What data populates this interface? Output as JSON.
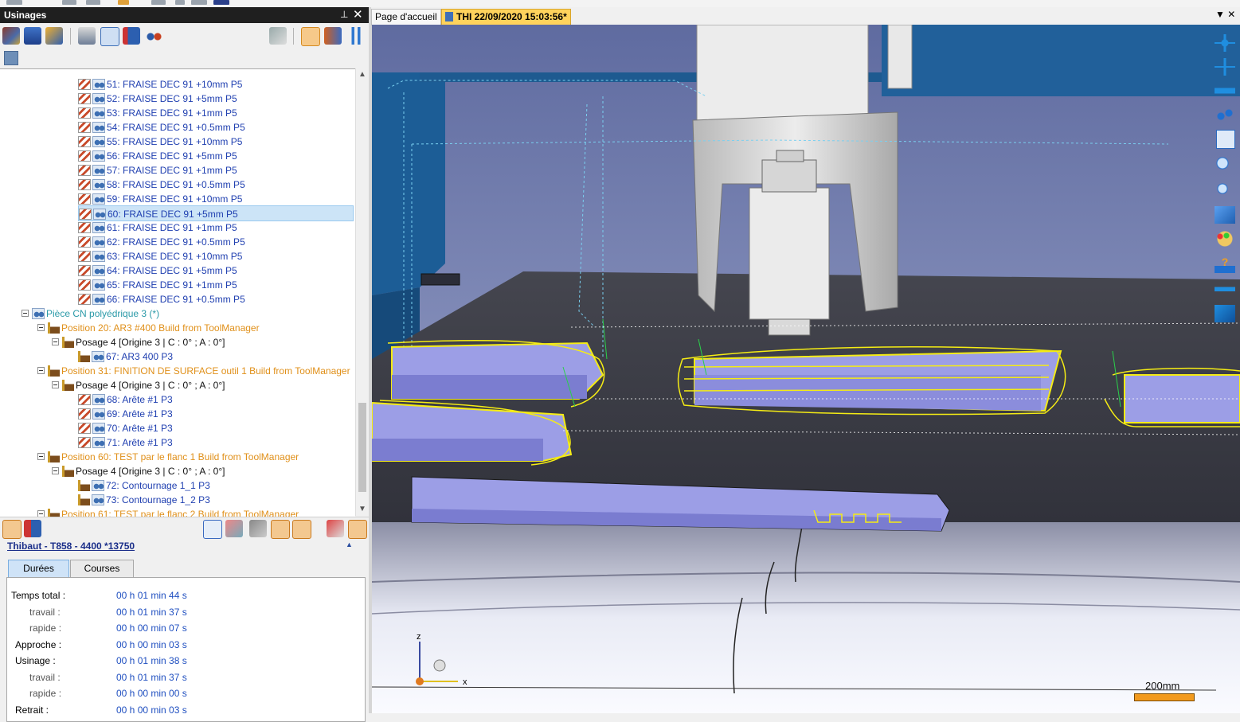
{
  "panel": {
    "title": "Usinages",
    "pin_glyph": "⊥",
    "close_glyph": "✕"
  },
  "toolbar_icons": [
    "machine-icon",
    "post-icon",
    "simulate-icon",
    "print-icon",
    "document-icon",
    "list-icon",
    "view-icon",
    "refresh-icon",
    "tree-icon",
    "toolpath-icon",
    "pause-icon"
  ],
  "tree": {
    "ops": [
      {
        "label": "51: FRAISE DEC 91 +10mm P5"
      },
      {
        "label": "52: FRAISE DEC 91 +5mm P5"
      },
      {
        "label": "53: FRAISE DEC 91 +1mm P5"
      },
      {
        "label": "54: FRAISE DEC 91 +0.5mm P5"
      },
      {
        "label": "55: FRAISE DEC 91 +10mm P5"
      },
      {
        "label": "56: FRAISE DEC 91 +5mm P5"
      },
      {
        "label": "57: FRAISE DEC 91 +1mm P5"
      },
      {
        "label": "58: FRAISE DEC 91 +0.5mm P5"
      },
      {
        "label": "59: FRAISE DEC 91 +10mm P5"
      },
      {
        "label": "60: FRAISE DEC 91 +5mm P5"
      },
      {
        "label": "61: FRAISE DEC 91 +1mm P5"
      },
      {
        "label": "62: FRAISE DEC 91 +0.5mm P5"
      },
      {
        "label": "63: FRAISE DEC 91 +10mm P5"
      },
      {
        "label": "64: FRAISE DEC 91 +5mm P5"
      },
      {
        "label": "65: FRAISE DEC 91 +1mm P5"
      },
      {
        "label": "66: FRAISE DEC 91 +0.5mm P5"
      }
    ],
    "piece": "Pièce CN polyédrique 3 (*)",
    "pos20": "Position 20: AR3 #400 Build from ToolManager",
    "posage_a": "Posage 4 [Origine 3 | C : 0° ; A : 0°]",
    "op67": "67: AR3 400 P3",
    "pos31": "Position 31: FINITION DE SURFACE outil 1 Build from ToolManager",
    "posage_b": "Posage 4 [Origine 3 | C : 0° ; A : 0°]",
    "op68": "68: Arête #1 P3",
    "op69": "69: Arête #1 P3",
    "op70": "70: Arête #1 P3",
    "op71": "71: Arête #1 P3",
    "pos60": "Position 60: TEST par le flanc 1 Build from ToolManager",
    "posage_c": "Posage 4 [Origine 3 | C : 0° ; A : 0°]",
    "op72": "72: Contournage 1_1 P3",
    "op73": "73: Contournage 1_2 P3",
    "pos61": "Position 61: TEST par le flanc 2 Build from ToolManager"
  },
  "info": {
    "machine": "Thibaut - T858 - 4400 *13750",
    "collapse_glyph": "▲"
  },
  "tabs": {
    "durees": "Durées",
    "courses": "Courses"
  },
  "stats": {
    "total_label": "Temps total :",
    "total": "00 h 01 min 44 s",
    "travail_label": "travail :",
    "travail": "00 h 01 min 37 s",
    "rapide_label": "rapide :",
    "rapide": "00 h 00 min 07 s",
    "approche_label": "Approche :",
    "approche": "00 h 00 min 03 s",
    "usinage_label": "Usinage :",
    "usinage": "00 h 01 min 38 s",
    "u_travail_label": "travail :",
    "u_travail": "00 h 01 min 37 s",
    "u_rapide_label": "rapide :",
    "u_rapide": "00 h 00 min 00 s",
    "retrait_label": "Retrait :",
    "retrait": "00 h 00 min 03 s"
  },
  "doc_tabs": {
    "home": "Page d'accueil",
    "current": "THI 22/09/2020 15:03:56*"
  },
  "viewport": {
    "scale_label": "200mm",
    "axis_z": "z",
    "axis_x": "x"
  },
  "colors": {
    "toolpath": "#f5ec14",
    "part": "#9c9ee6",
    "table": "#3a3b48",
    "machine_blue": "#1c5d96"
  }
}
